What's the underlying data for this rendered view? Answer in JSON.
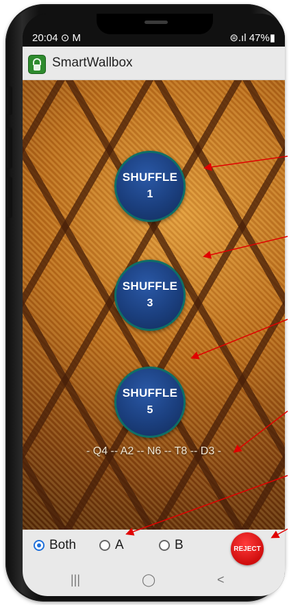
{
  "status_bar": {
    "time": "20:04 ⊙ M",
    "right": "⊜.ıl 47%▮"
  },
  "app": {
    "title": "SmartWallbox"
  },
  "buttons": [
    {
      "label": "SHUFFLE",
      "number": "1"
    },
    {
      "label": "SHUFFLE",
      "number": "3"
    },
    {
      "label": "SHUFFLE",
      "number": "5"
    }
  ],
  "code_sequence": "- Q4 -- A2 -- N6 -- T8 -- D3 -",
  "radios": {
    "selected": "Both",
    "options": [
      "Both",
      "A",
      "B"
    ]
  },
  "reject": {
    "label": "REJECT",
    "color": "#e01818"
  },
  "nav": {
    "recent": "|||",
    "home": "◯",
    "back": "<"
  },
  "colors": {
    "annotation_arrow": "#e00000",
    "shuffle_fill": "#1b3f7e"
  }
}
